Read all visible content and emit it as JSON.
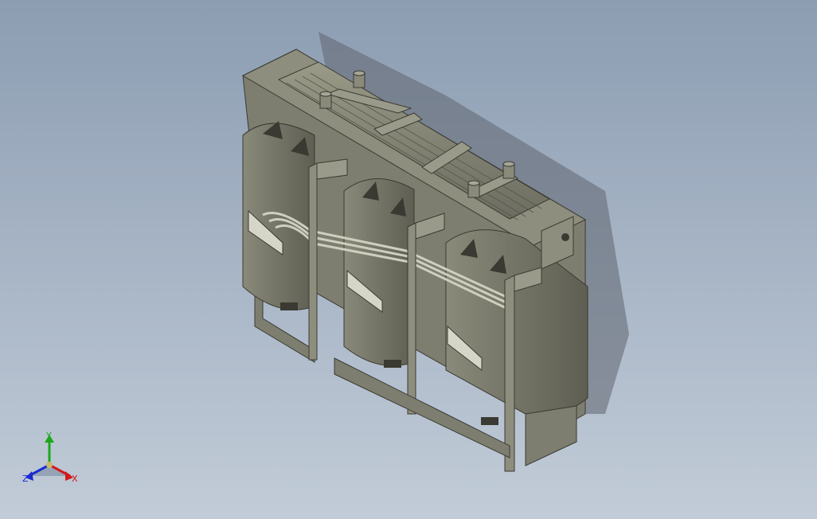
{
  "viewport": {
    "background_top": "#8c9db2",
    "background_bottom": "#c2ccd8",
    "model_fill": "#7c7c6e",
    "model_dark": "#4e4e44",
    "model_light": "#a0a090"
  },
  "triad": {
    "y_label": "Y",
    "z_label": "Z",
    "x_label": "X",
    "y_color": "#1aa81a",
    "z_color": "#1a2ad0",
    "x_color": "#d01a1a"
  }
}
